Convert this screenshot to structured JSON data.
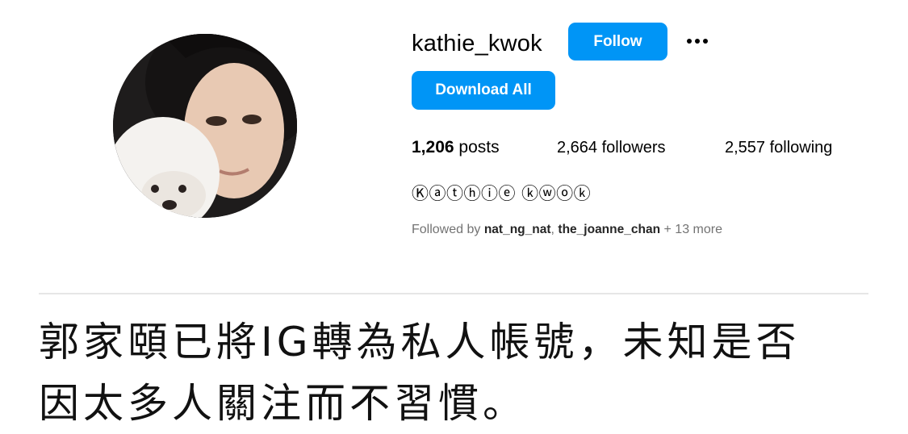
{
  "profile": {
    "username": "kathie_kwok",
    "follow_label": "Follow",
    "more_icon": "more-horizontal-icon",
    "download_label": "Download All",
    "stats": {
      "posts_count": "1,206",
      "posts_label": "posts",
      "followers": "2,664 followers",
      "following": "2,557 following"
    },
    "bio": "Ⓚⓐⓣⓗⓘⓔ ⓚⓦⓞⓚ",
    "followed_by": {
      "prefix": "Followed by",
      "name1": "nat_ng_nat",
      "separator": ",",
      "name2": "the_joanne_chan",
      "more": "+ 13 more"
    }
  },
  "caption": {
    "line1": "郭家頤已將IG轉為私人帳號，未知是否",
    "line2": "因太多人關注而不習慣。"
  },
  "colors": {
    "accent": "#0095f6",
    "muted_text": "#737373",
    "divider": "#e6e6e6"
  }
}
